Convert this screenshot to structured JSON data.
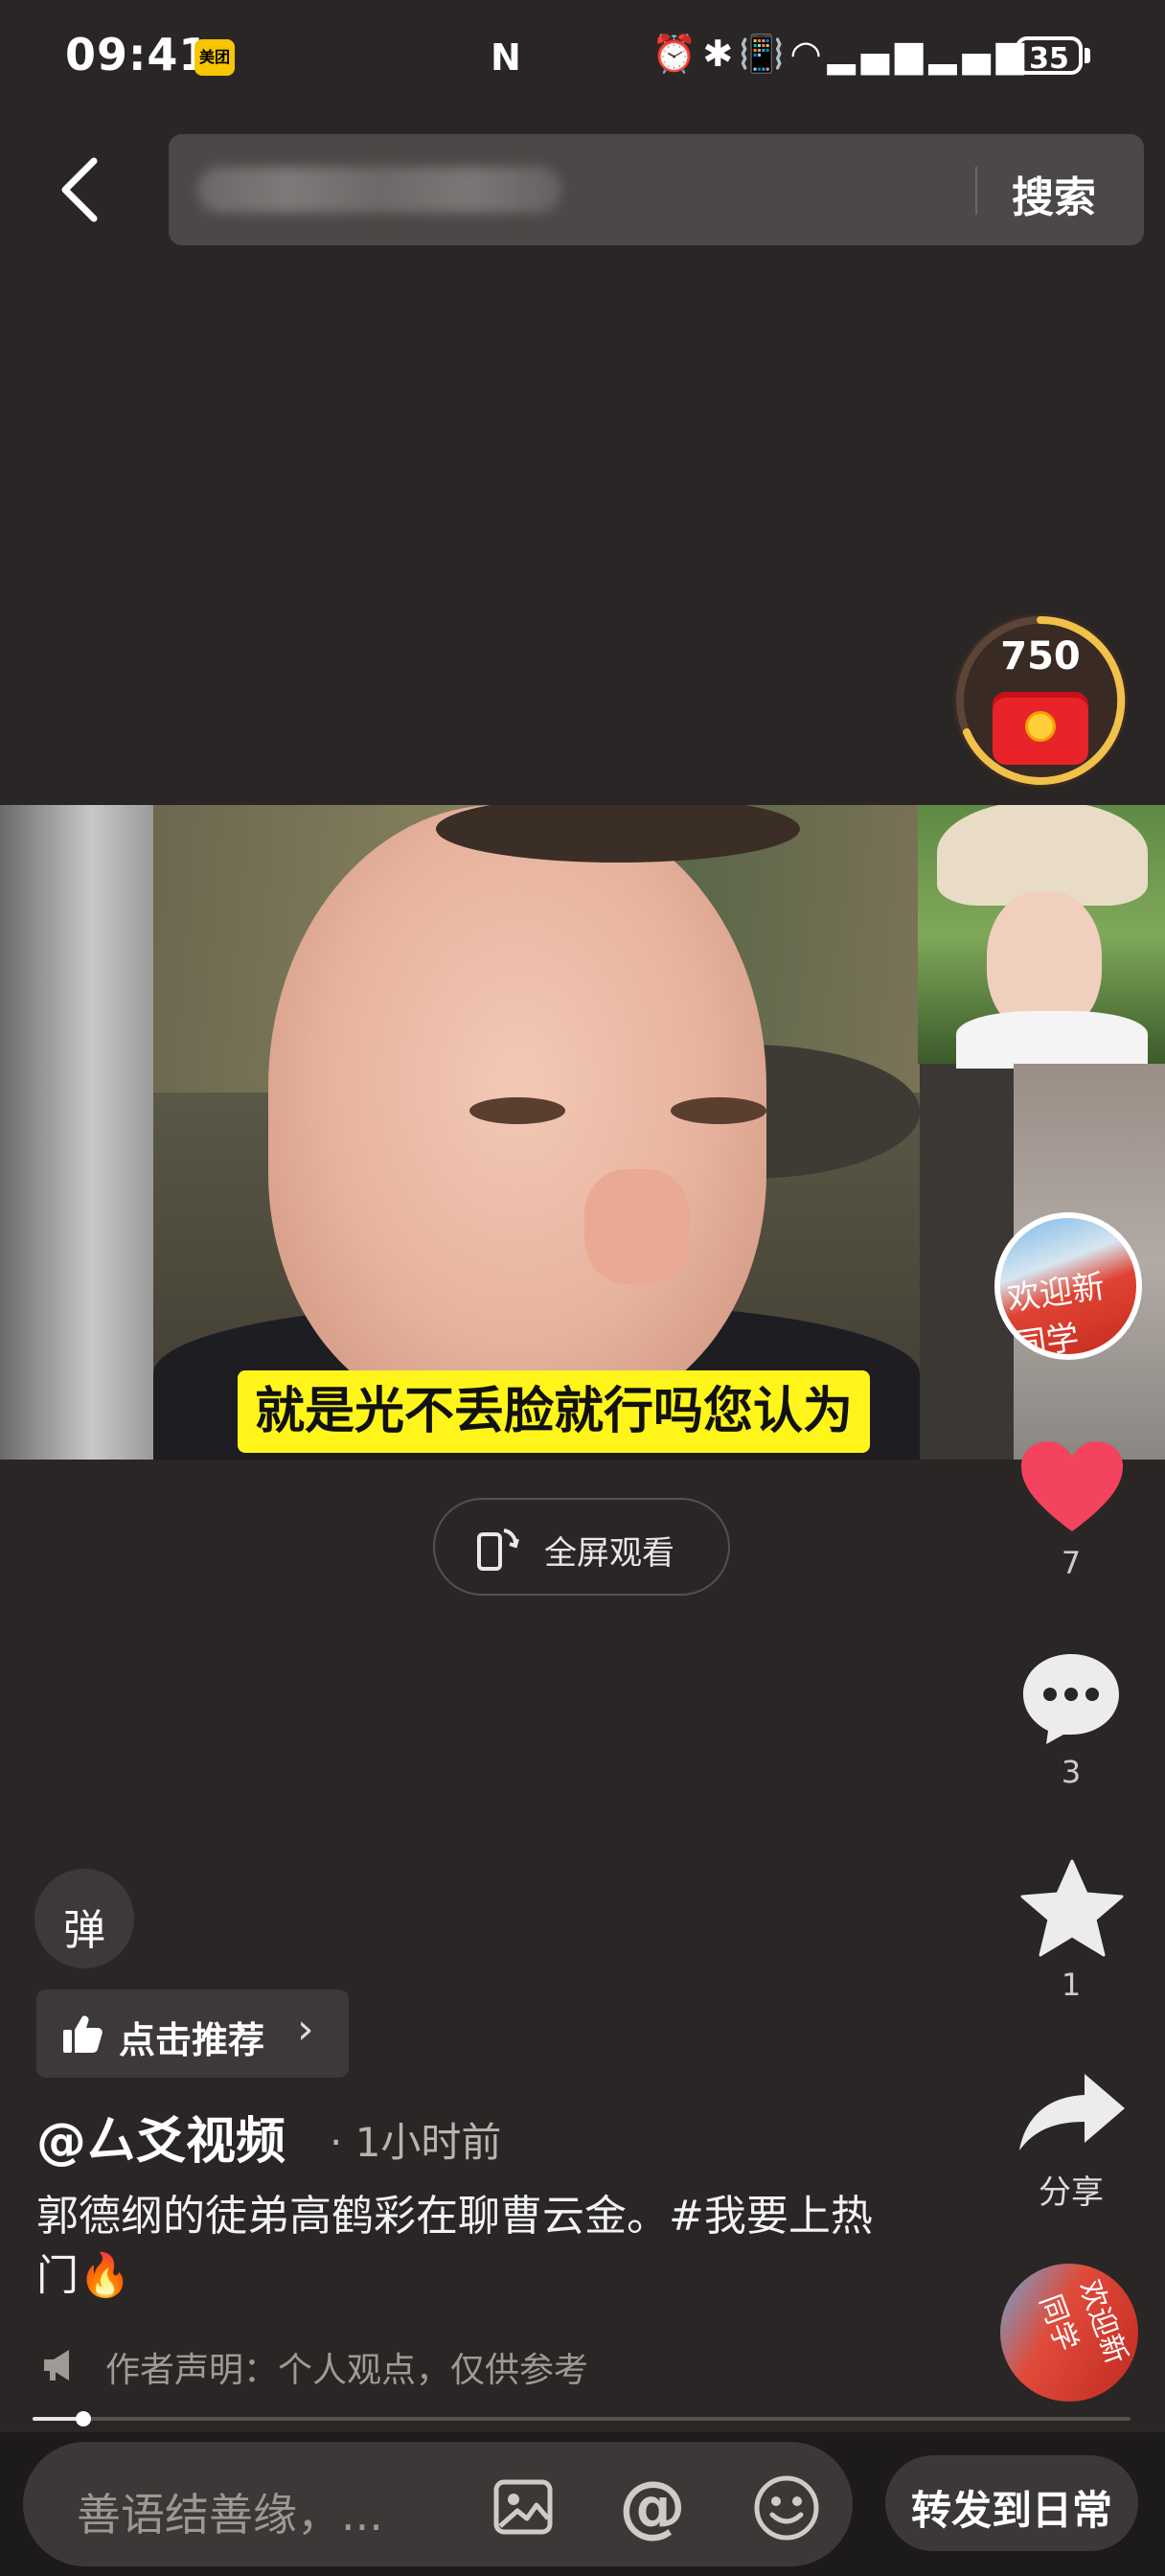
{
  "status_bar": {
    "time": "09:41",
    "app_badge": "美团",
    "nfc": "N",
    "battery": "35"
  },
  "search": {
    "button_label": "搜索"
  },
  "red_packet": {
    "count": "750"
  },
  "video": {
    "caption": "就是光不丢脸就行吗您认为"
  },
  "fullscreen": {
    "label": "全屏观看"
  },
  "music": {
    "disc_text": "欢迎新同学"
  },
  "actions": {
    "like_count": "7",
    "comment_count": "3",
    "favorite_count": "1",
    "share_label": "分享"
  },
  "danmaku": {
    "label": "弹"
  },
  "recommend": {
    "label": "点击推荐"
  },
  "post": {
    "author": "@厶爻视频",
    "time": "· 1小时前",
    "description": "郭德纲的徒弟高鹤彩在聊曹云金。#我要上热门🔥",
    "disclaimer": "作者声明：个人观点，仅供参考"
  },
  "progress": {
    "value": 0.046
  },
  "bottom_bar": {
    "comment_placeholder": "善语结善缘，...",
    "forward_label": "转发到日常"
  },
  "colors": {
    "background": "#2a2625",
    "like": "#f4435e",
    "caption_bg": "#fff51a",
    "red_packet": "#e8232a"
  }
}
